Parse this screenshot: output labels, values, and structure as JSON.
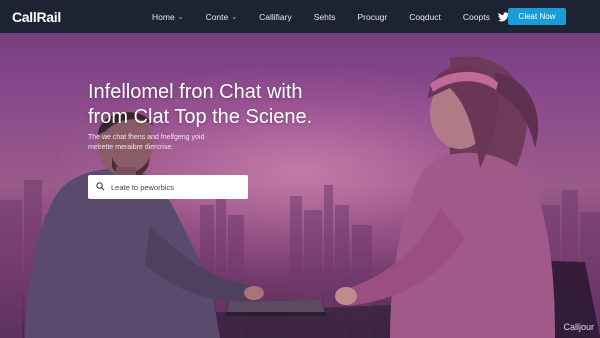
{
  "brand": {
    "name": "CallRail"
  },
  "nav": {
    "items": [
      {
        "label": "Home",
        "has_dropdown": true
      },
      {
        "label": "Conte",
        "has_dropdown": true
      },
      {
        "label": "Callifiary",
        "has_dropdown": false
      },
      {
        "label": "Sehts",
        "has_dropdown": false
      },
      {
        "label": "Procugr",
        "has_dropdown": false
      },
      {
        "label": "Coqduct",
        "has_dropdown": false
      },
      {
        "label": "Coopts",
        "has_dropdown": false
      }
    ],
    "icons": [
      "twitter-icon",
      "user-icon",
      "location-icon"
    ],
    "cta_label": "Cleat Now"
  },
  "hero": {
    "headline_line1": "Infellomel fron Chat with",
    "headline_line2": "from Clat Top the Sciene.",
    "subtext_line1": "The we chat fhens and fnelfgeng yoid",
    "subtext_line2": "melrette meraibre diercrise.",
    "search_placeholder": "Leate to peworbics"
  },
  "watermark": "Calljour",
  "colors": {
    "nav_bg": "#1d2333",
    "cta": "#1b9bd7",
    "hero_tint": "#8b4a8c"
  }
}
